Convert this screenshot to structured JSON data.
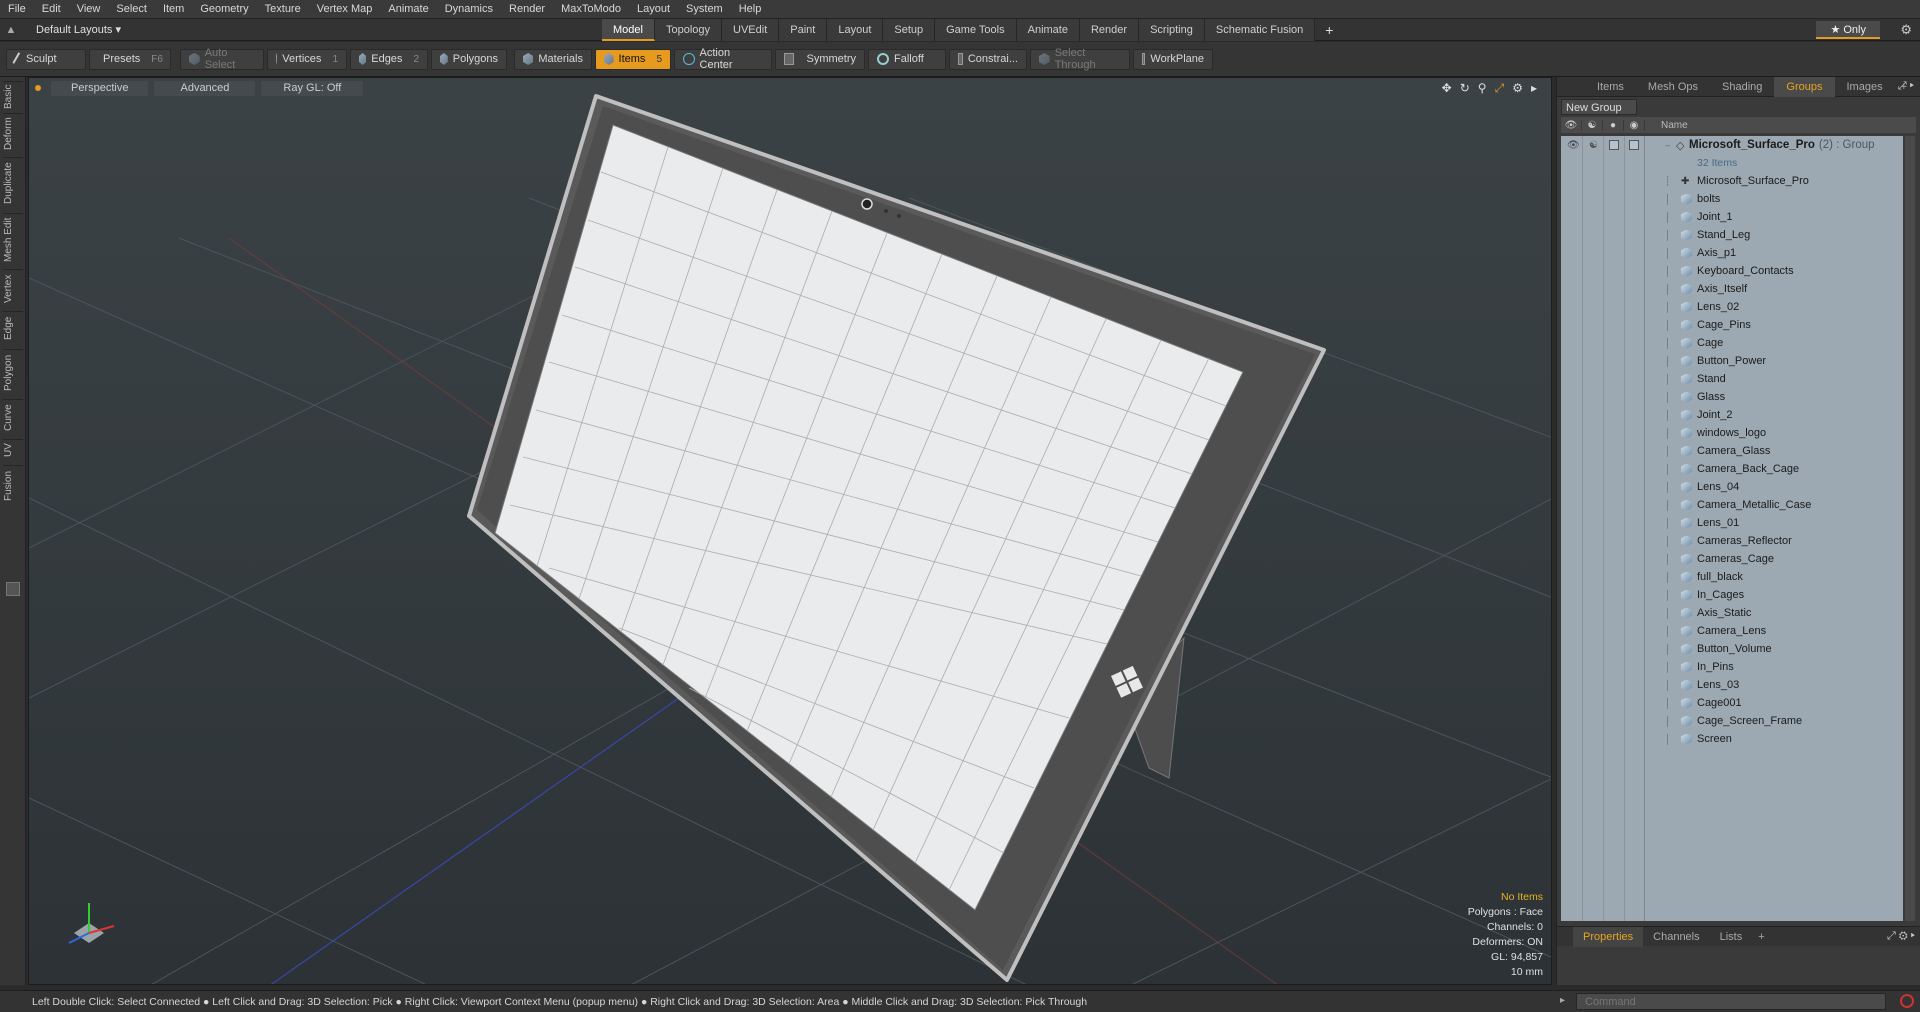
{
  "menu": [
    "File",
    "Edit",
    "View",
    "Select",
    "Item",
    "Geometry",
    "Texture",
    "Vertex Map",
    "Animate",
    "Dynamics",
    "Render",
    "MaxToModo",
    "Layout",
    "System",
    "Help"
  ],
  "layout": {
    "dropdown": "Default Layouts ▾",
    "tabs": [
      "Model",
      "Topology",
      "UVEdit",
      "Paint",
      "Layout",
      "Setup",
      "Game Tools",
      "Animate",
      "Render",
      "Scripting",
      "Schematic Fusion"
    ],
    "active_tab": "Model",
    "plus": "+",
    "only": "★ Only",
    "gear": "⚙"
  },
  "toolbar": {
    "sculpt": "Sculpt",
    "presets": "Presets",
    "presets_key": "F6",
    "auto_select": "Auto Select",
    "vertices": "Vertices",
    "vertices_count": "1",
    "edges": "Edges",
    "edges_count": "2",
    "polygons": "Polygons",
    "materials": "Materials",
    "items": "Items",
    "items_count": "5",
    "action_center": "Action Center",
    "symmetry": "Symmetry",
    "falloff": "Falloff",
    "constrain": "Constrai...",
    "select_through": "Select Through",
    "workplane": "WorkPlane"
  },
  "left_tabs": [
    "Basic",
    "Deform",
    "Duplicate",
    "Mesh Edit",
    "Vertex",
    "Edge",
    "Polygon",
    "Curve",
    "UV",
    "Fusion"
  ],
  "viewport": {
    "perspective": "Perspective",
    "advanced": "Advanced",
    "raygl": "Ray GL: Off",
    "info": {
      "no_items": "No Items",
      "polygons": "Polygons : Face",
      "channels": "Channels: 0",
      "deformers": "Deformers: ON",
      "gl": "GL: 94,857",
      "scale": "10 mm"
    }
  },
  "right_panel": {
    "tabs": [
      "Items",
      "Mesh Ops",
      "Shading",
      "Groups",
      "Images"
    ],
    "active_tab": "Groups",
    "plus": "+",
    "new_group": "New Group",
    "column_name": "Name",
    "group": {
      "name": "Microsoft_Surface_Pro",
      "suffix": "(2) : Group",
      "count": "32 Items"
    },
    "locator": "Microsoft_Surface_Pro",
    "items": [
      "bolts",
      "Joint_1",
      "Stand_Leg",
      "Axis_p1",
      "Keyboard_Contacts",
      "Axis_Itself",
      "Lens_02",
      "Cage_Pins",
      "Cage",
      "Button_Power",
      "Stand",
      "Glass",
      "Joint_2",
      "windows_logo",
      "Camera_Glass",
      "Camera_Back_Cage",
      "Lens_04",
      "Camera_Metallic_Case",
      "Lens_01",
      "Cameras_Reflector",
      "Cameras_Cage",
      "full_black",
      "In_Cages",
      "Axis_Static",
      "Camera_Lens",
      "Button_Volume",
      "In_Pins",
      "Lens_03",
      "Cage001",
      "Cage_Screen_Frame",
      "Screen"
    ],
    "bottom_tabs": [
      "Properties",
      "Channels",
      "Lists"
    ],
    "bottom_active": "Properties"
  },
  "status": {
    "text": "Left Double Click: Select Connected ● Left Click and Drag: 3D Selection: Pick ● Right Click: Viewport Context Menu (popup menu) ● Right Click and Drag: 3D Selection: Area ● Middle Click and Drag: 3D Selection: Pick Through",
    "command_placeholder": "Command"
  },
  "colors": {
    "accent": "#e69a1e",
    "list_bg": "#9ca8b2",
    "viewport_bg": "#363d41"
  }
}
